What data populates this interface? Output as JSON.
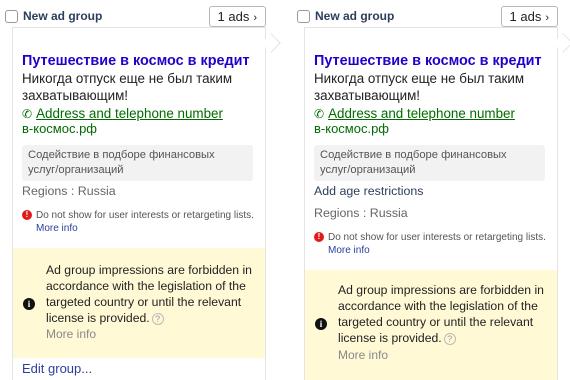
{
  "groups": [
    {
      "name": "New ad group",
      "ads_label": "1 ads",
      "ad": {
        "title": "Путешествие в космос в кредит",
        "text": "Никогда отпуск еще не был таким захватывающим!",
        "contact_link": "Address and telephone number",
        "display_url": "в-космос.рф",
        "category": "Содействие в подборе финансовых услуг/организаций"
      },
      "regions": "Regions : Russia",
      "warning_text": "Do not show for user interests or retargeting lists.",
      "warning_more": "More info",
      "notice_text": "Ad group impressions are forbidden in accordance with the legislation of the targeted country or until the relevant license is provided.",
      "notice_more": "More info",
      "edit_link": "Edit group..."
    },
    {
      "name": "New ad group",
      "ads_label": "1 ads",
      "ad": {
        "title": "Путешествие в космос в кредит",
        "text": "Никогда отпуск еще не был таким захватывающим!",
        "contact_link": "Address and telephone number",
        "display_url": "в-космос.рф",
        "category": "Содействие в подборе финансовых услуг/организаций"
      },
      "age_restrictions_link": "Add age restrictions",
      "regions": "Regions : Russia",
      "warning_text": "Do not show for user interests or retargeting lists.",
      "warning_more": "More info",
      "notice_text": "Ad group impressions are forbidden in accordance with the legislation of the targeted country or until the relevant license is provided.",
      "notice_more": "More info"
    }
  ],
  "icons": {
    "chevron": "chevron-right-icon",
    "phone": "phone-icon",
    "warning": "exclamation-icon",
    "info": "info-icon",
    "help": "question-icon"
  },
  "colors": {
    "ad_title": "#2200cc",
    "ad_link": "#006b00",
    "notice_bg": "#fff9d6",
    "warning": "#e11b1b",
    "link": "#2c3e9c"
  }
}
